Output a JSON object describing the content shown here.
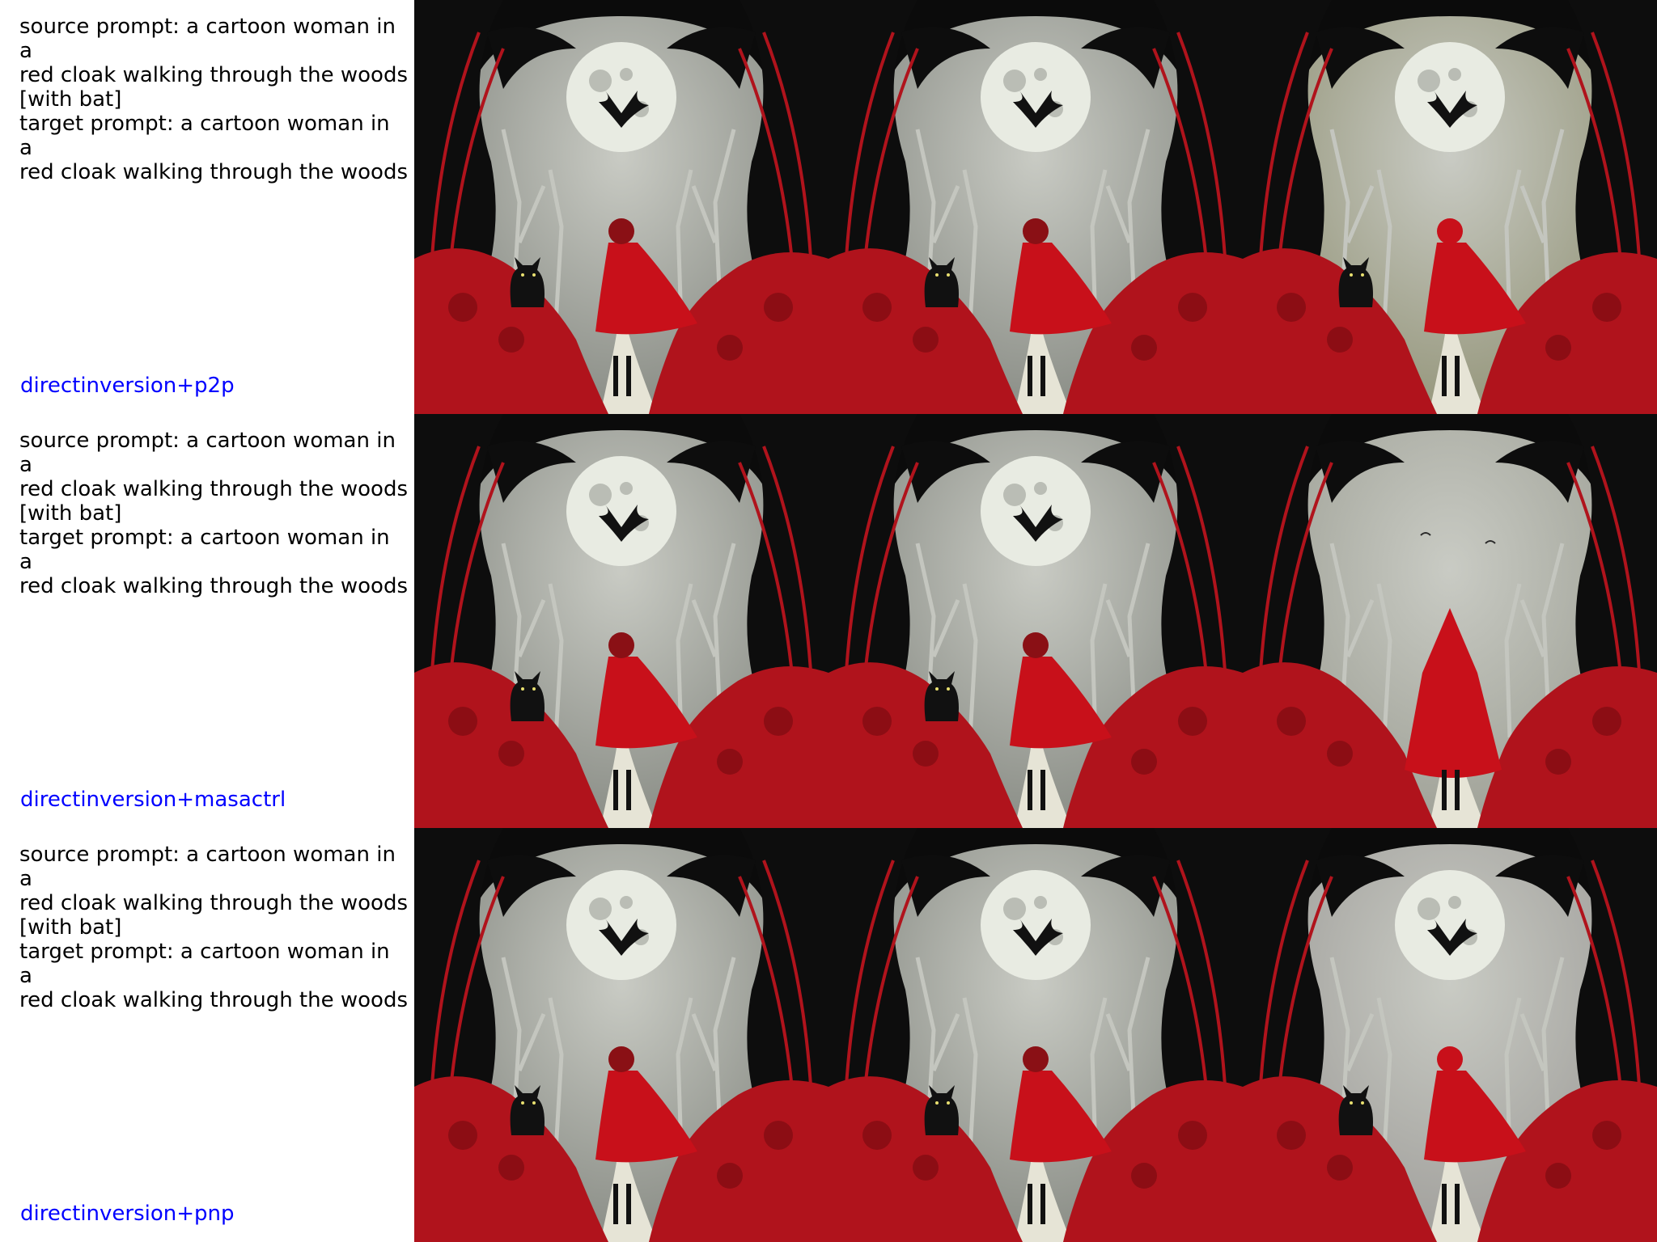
{
  "rows": [
    {
      "source_prompt": "source prompt: a cartoon woman in a\nred cloak walking through the woods\n[with bat]",
      "target_prompt": "target prompt: a cartoon woman in a\nred cloak walking through the woods",
      "method": "directinversion+p2p",
      "images": [
        {
          "name": "source-image",
          "has_bat": true,
          "has_cat": true,
          "hood": "down",
          "sky": "#8f928b"
        },
        {
          "name": "reconstructed-image",
          "has_bat": true,
          "has_cat": true,
          "hood": "down",
          "sky": "#8f928b"
        },
        {
          "name": "edited-image",
          "has_bat": true,
          "has_cat": true,
          "hood": "up",
          "sky": "#9a9b82"
        }
      ]
    },
    {
      "source_prompt": "source prompt: a cartoon woman in a\nred cloak walking through the woods\n[with bat]",
      "target_prompt": "target prompt: a cartoon woman in a\nred cloak walking through the woods",
      "method": "directinversion+masactrl",
      "images": [
        {
          "name": "source-image",
          "has_bat": true,
          "has_cat": true,
          "hood": "down",
          "sky": "#8f928b"
        },
        {
          "name": "reconstructed-image",
          "has_bat": true,
          "has_cat": true,
          "hood": "down",
          "sky": "#8f928b"
        },
        {
          "name": "edited-image",
          "has_bat": false,
          "has_cat": false,
          "hood": "pointed",
          "sky": "#a3a59b"
        }
      ]
    },
    {
      "source_prompt": "source prompt: a cartoon woman in a\nred cloak walking through the woods\n[with bat]",
      "target_prompt": "target prompt: a cartoon woman in a\nred cloak walking through the woods",
      "method": "directinversion+pnp",
      "images": [
        {
          "name": "source-image",
          "has_bat": true,
          "has_cat": true,
          "hood": "down",
          "sky": "#8f928b"
        },
        {
          "name": "reconstructed-image",
          "has_bat": true,
          "has_cat": true,
          "hood": "down",
          "sky": "#8f928b"
        },
        {
          "name": "edited-image",
          "has_bat": true,
          "has_cat": true,
          "hood": "up",
          "sky": "#a4a39f"
        }
      ]
    }
  ],
  "colors": {
    "prompt_text": "#000000",
    "method_text": "#0000ff",
    "cloak": "#c8101a",
    "foliage": "#b0131c",
    "tree": "#0d0d0d",
    "moon": "#e8ebe2"
  }
}
